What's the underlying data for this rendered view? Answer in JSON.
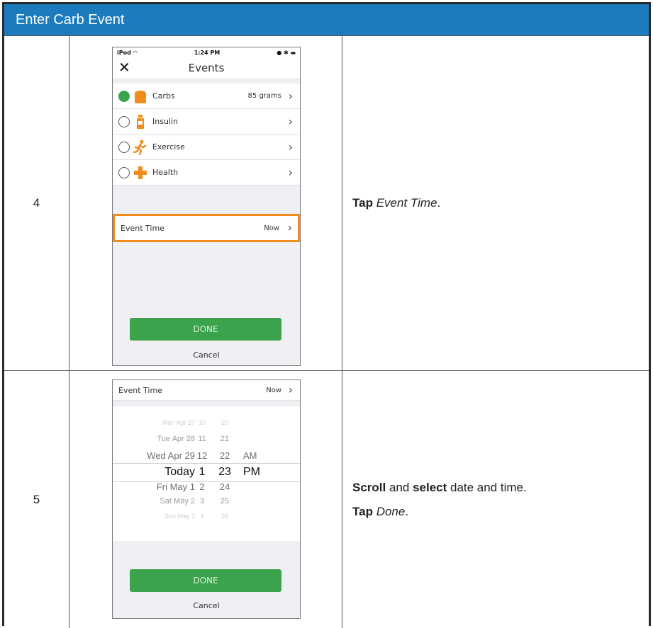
{
  "header": {
    "title": "Enter Carb Event"
  },
  "steps": [
    {
      "number": "4",
      "instructions": [
        {
          "bold": "Tap",
          "italic": "Event Time",
          "end": "."
        }
      ]
    },
    {
      "number": "5",
      "instructions": [
        {
          "bold1": "Scroll",
          "and": " and ",
          "bold2": "select",
          "rest": " date and time."
        },
        {
          "bold": "Tap",
          "italic": "Done",
          "end": "."
        }
      ]
    }
  ],
  "screen_events": {
    "status": {
      "carrier": "iPod",
      "time": "1:24 PM"
    },
    "title": "Events",
    "close_glyph": "✕",
    "items": [
      {
        "label": "Carbs",
        "value": "85 grams",
        "selected": true,
        "icon": "carbs-icon",
        "color": "#f28c1a"
      },
      {
        "label": "Insulin",
        "value": "",
        "selected": false,
        "icon": "insulin-icon",
        "color": "#f28c1a"
      },
      {
        "label": "Exercise",
        "value": "",
        "selected": false,
        "icon": "exercise-icon",
        "color": "#f28c1a"
      },
      {
        "label": "Health",
        "value": "",
        "selected": false,
        "icon": "health-icon",
        "color": "#f28c1a"
      }
    ],
    "event_time": {
      "label": "Event Time",
      "value": "Now"
    },
    "done": "DONE",
    "cancel": "Cancel"
  },
  "screen_picker": {
    "event_time": {
      "label": "Event Time",
      "value": "Now"
    },
    "rows": [
      {
        "date": "Mon Apr 27",
        "hour": "10",
        "minute": "20",
        "ampm": ""
      },
      {
        "date": "Tue Apr 28",
        "hour": "11",
        "minute": "21",
        "ampm": ""
      },
      {
        "date": "Wed Apr 29",
        "hour": "12",
        "minute": "22",
        "ampm": "AM"
      },
      {
        "date": "Today",
        "hour": "1",
        "minute": "23",
        "ampm": "PM"
      },
      {
        "date": "Fri May 1",
        "hour": "2",
        "minute": "24",
        "ampm": ""
      },
      {
        "date": "Sat May 2",
        "hour": "3",
        "minute": "25",
        "ampm": ""
      },
      {
        "date": "Sun May 3",
        "hour": "4",
        "minute": "26",
        "ampm": ""
      }
    ],
    "selected_index": 3,
    "done": "DONE",
    "cancel": "Cancel"
  },
  "colors": {
    "header": "#1b7bbd",
    "done": "#3aa34b",
    "highlight": "#f28c1a"
  }
}
